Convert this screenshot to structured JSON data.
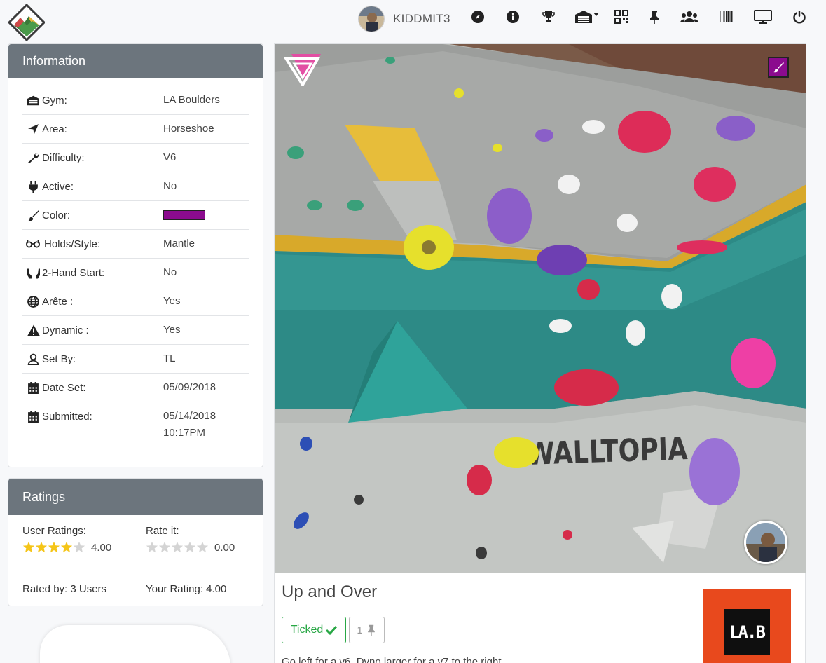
{
  "navbar": {
    "username": "KIDDMIT3",
    "icons": [
      "compass-icon",
      "info-icon",
      "trophy-icon",
      "warehouse-icon",
      "qrcode-icon",
      "thumbtack-icon",
      "users-icon",
      "barcode-icon",
      "desktop-icon",
      "power-icon"
    ]
  },
  "info": {
    "title": "Information",
    "rows": [
      {
        "label": "Gym:",
        "value": "LA Boulders",
        "icon": "warehouse-icon"
      },
      {
        "label": "Area:",
        "value": "Horseshoe",
        "icon": "location-arrow-icon"
      },
      {
        "label": "Difficulty:",
        "value": "V6",
        "icon": "wrench-icon"
      },
      {
        "label": "Active:",
        "value": "No",
        "icon": "plug-icon"
      },
      {
        "label": "Color:",
        "value": "",
        "icon": "paint-brush-icon",
        "swatch": "#8b0b8e"
      },
      {
        "label": "Holds/Style:",
        "value": "Mantle",
        "icon": "glasses-icon"
      },
      {
        "label": "2-Hand Start:",
        "value": "No",
        "icon": "hands-icon"
      },
      {
        "label": "Arête :",
        "value": "Yes",
        "icon": "globe-icon"
      },
      {
        "label": "Dynamic :",
        "value": "Yes",
        "icon": "warning-icon"
      },
      {
        "label": "Set By:",
        "value": "TL",
        "icon": "user-icon"
      },
      {
        "label": "Date Set:",
        "value": "05/09/2018",
        "icon": "calendar-icon"
      },
      {
        "label": "Submitted:",
        "value": "05/14/2018\n10:17PM",
        "icon": "calendar-icon"
      }
    ]
  },
  "ratings": {
    "title": "Ratings",
    "user_ratings_label": "User Ratings:",
    "user_rating_stars": 4,
    "user_rating_value": "4.00",
    "rate_it_label": "Rate it:",
    "rate_it_stars": 0,
    "rate_it_value": "0.00",
    "rated_by": "Rated by: 3 Users",
    "your_rating": "Your Rating: 4.00"
  },
  "route": {
    "title": "Up and Over",
    "ticked_label": "Ticked",
    "pin_count": "1",
    "description": "Go left for a v6. Dyno larger for a v7 to the right",
    "gym_logo_text": "LA.B",
    "wall_text": "WALLTOPIA"
  },
  "colors": {
    "header_gray": "#6c757d",
    "route_color": "#8b0b8e",
    "ticked_green": "#28a745",
    "star_gold": "#f5c518",
    "gym_orange": "#e8491d"
  }
}
